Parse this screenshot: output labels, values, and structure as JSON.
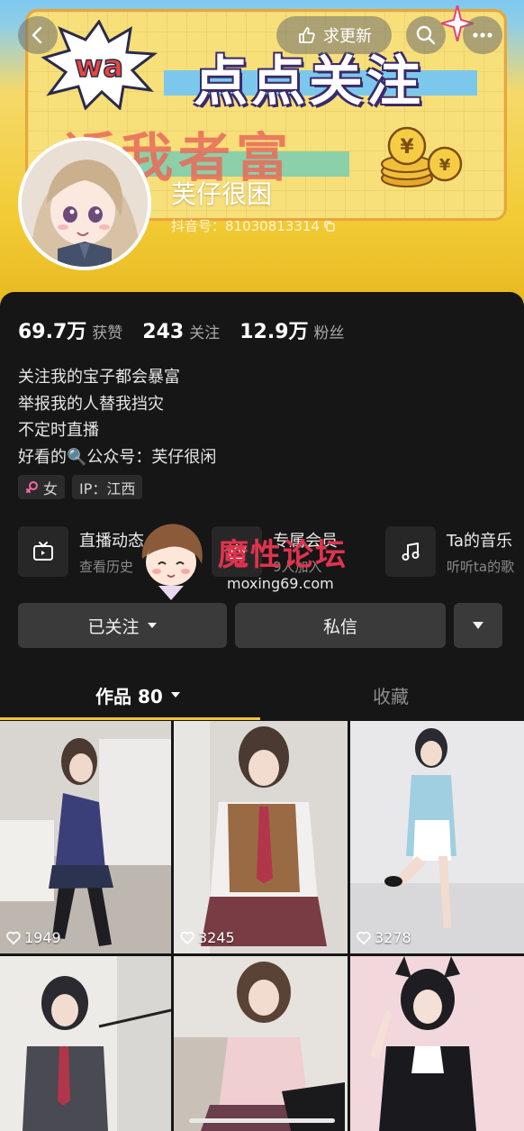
{
  "banner": {
    "headline": "点点关注",
    "subheadline": "近我者富",
    "burst_text": "wa"
  },
  "nav": {
    "update_label": "求更新",
    "icons": [
      "back-icon",
      "request-update-icon",
      "search-icon",
      "more-icon"
    ]
  },
  "profile": {
    "nickname": "芙仔很困",
    "douyin_id": "抖音号：81030813314"
  },
  "stats": [
    {
      "value": "69.7万",
      "label": "获赞"
    },
    {
      "value": "243",
      "label": "关注"
    },
    {
      "value": "12.9万",
      "label": "粉丝"
    }
  ],
  "bio": [
    "关注我的宝子都会暴富",
    "举报我的人替我挡灾",
    "不定时直播",
    "好看的🔍公众号：芙仔很闲"
  ],
  "tags": {
    "gender": "女",
    "ip": "IP：江西"
  },
  "features": [
    {
      "title": "直播动态",
      "sub": "查看历史",
      "icon": "tv-icon"
    },
    {
      "title": "专属会员",
      "sub": "9人加入",
      "icon": "member-icon"
    },
    {
      "title": "Ta的音乐",
      "sub": "听听ta的歌",
      "icon": "music-icon"
    }
  ],
  "watermark": {
    "title": "魔性论坛",
    "url": "moxing69.com"
  },
  "actions": {
    "followed_label": "已关注",
    "message_label": "私信"
  },
  "tabs": {
    "works_label": "作品 80",
    "favorites_label": "收藏"
  },
  "videos": [
    {
      "likes": "1949"
    },
    {
      "likes": "3245"
    },
    {
      "likes": "3278"
    },
    {
      "likes": ""
    },
    {
      "likes": ""
    },
    {
      "likes": ""
    }
  ],
  "colors": {
    "accent_underline": "#f7c531",
    "background": "#161616",
    "watermark_red": "#e0334e"
  }
}
